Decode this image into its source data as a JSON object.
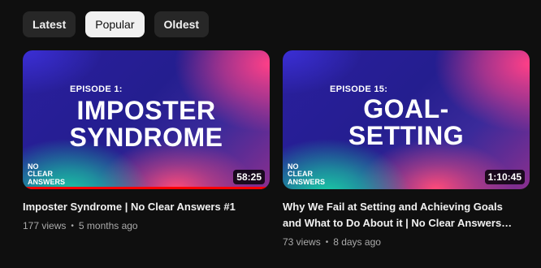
{
  "filters": {
    "chips": [
      "Latest",
      "Popular",
      "Oldest"
    ],
    "active": "Popular"
  },
  "videos": [
    {
      "thumb": {
        "episode": "EPISODE 1:",
        "title_line1": "IMPOSTER",
        "title_line2": "SYNDROME",
        "brand_line1": "NO",
        "brand_line2": "CLEAR",
        "brand_line3": "ANSWERS"
      },
      "duration": "58:25",
      "progress": 1.0,
      "title_line1": "Imposter Syndrome | No Clear Answers #1",
      "title_line2": "",
      "views": "177 views",
      "age": "5 months ago"
    },
    {
      "thumb": {
        "episode": "EPISODE 15:",
        "title_line1": "GOAL-",
        "title_line2": "SETTING",
        "brand_line1": "NO",
        "brand_line2": "CLEAR",
        "brand_line3": "ANSWERS"
      },
      "duration": "1:10:45",
      "progress": 0,
      "title_line1": "Why We Fail at Setting and Achieving Goals",
      "title_line2": "and What to Do About it | No Clear Answers…",
      "views": "73 views",
      "age": "8 days ago"
    }
  ],
  "colors": {
    "background": "#0f0f0f",
    "chip": "#272727",
    "chip_active": "#f1f1f1",
    "progress": "#ff0000"
  }
}
